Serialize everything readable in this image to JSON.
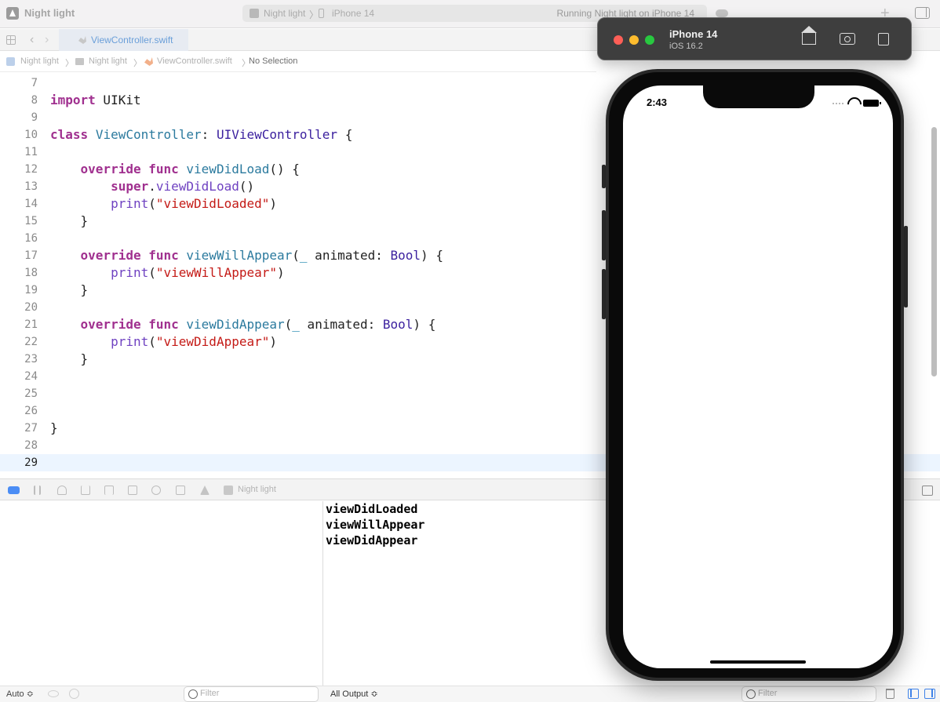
{
  "window": {
    "title": "Night light",
    "scheme": "Night light",
    "device": "iPhone 14",
    "separator": "〉",
    "status": "Running Night light on iPhone 14"
  },
  "tabs": [
    {
      "label": "ViewController.swift",
      "active": true
    }
  ],
  "breadcrumb": {
    "items": [
      "Night light",
      "Night light",
      "ViewController.swift",
      "No Selection"
    ],
    "separator": "〉"
  },
  "editor": {
    "current_line": 29,
    "lines": [
      {
        "n": "7",
        "tokens": []
      },
      {
        "n": "8",
        "tokens": [
          {
            "t": "import",
            "c": "kw"
          },
          {
            "t": " UIKit",
            "c": ""
          }
        ]
      },
      {
        "n": "9",
        "tokens": []
      },
      {
        "n": "10",
        "tokens": [
          {
            "t": "class",
            "c": "kw"
          },
          {
            "t": " ",
            "c": ""
          },
          {
            "t": "ViewController",
            "c": "fn"
          },
          {
            "t": ": ",
            "c": ""
          },
          {
            "t": "UIViewController",
            "c": "tp"
          },
          {
            "t": " {",
            "c": ""
          }
        ]
      },
      {
        "n": "11",
        "tokens": []
      },
      {
        "n": "12",
        "tokens": [
          {
            "t": "    ",
            "c": ""
          },
          {
            "t": "override",
            "c": "kw"
          },
          {
            "t": " ",
            "c": ""
          },
          {
            "t": "func",
            "c": "kw"
          },
          {
            "t": " ",
            "c": ""
          },
          {
            "t": "viewDidLoad",
            "c": "fn"
          },
          {
            "t": "() {",
            "c": ""
          }
        ]
      },
      {
        "n": "13",
        "tokens": [
          {
            "t": "        ",
            "c": ""
          },
          {
            "t": "super",
            "c": "kw"
          },
          {
            "t": ".",
            "c": ""
          },
          {
            "t": "viewDidLoad",
            "c": "fc"
          },
          {
            "t": "()",
            "c": ""
          }
        ]
      },
      {
        "n": "14",
        "tokens": [
          {
            "t": "        ",
            "c": ""
          },
          {
            "t": "print",
            "c": "fc"
          },
          {
            "t": "(",
            "c": ""
          },
          {
            "t": "\"viewDidLoaded\"",
            "c": "st"
          },
          {
            "t": ")",
            "c": ""
          }
        ]
      },
      {
        "n": "15",
        "tokens": [
          {
            "t": "    }",
            "c": ""
          }
        ]
      },
      {
        "n": "16",
        "tokens": []
      },
      {
        "n": "17",
        "tokens": [
          {
            "t": "    ",
            "c": ""
          },
          {
            "t": "override",
            "c": "kw"
          },
          {
            "t": " ",
            "c": ""
          },
          {
            "t": "func",
            "c": "kw"
          },
          {
            "t": " ",
            "c": ""
          },
          {
            "t": "viewWillAppear",
            "c": "fn"
          },
          {
            "t": "(",
            "c": ""
          },
          {
            "t": "_",
            "c": "un"
          },
          {
            "t": " animated: ",
            "c": ""
          },
          {
            "t": "Bool",
            "c": "tp"
          },
          {
            "t": ") {",
            "c": ""
          }
        ]
      },
      {
        "n": "18",
        "tokens": [
          {
            "t": "        ",
            "c": ""
          },
          {
            "t": "print",
            "c": "fc"
          },
          {
            "t": "(",
            "c": ""
          },
          {
            "t": "\"viewWillAppear\"",
            "c": "st"
          },
          {
            "t": ")",
            "c": ""
          }
        ]
      },
      {
        "n": "19",
        "tokens": [
          {
            "t": "    }",
            "c": ""
          }
        ]
      },
      {
        "n": "20",
        "tokens": []
      },
      {
        "n": "21",
        "tokens": [
          {
            "t": "    ",
            "c": ""
          },
          {
            "t": "override",
            "c": "kw"
          },
          {
            "t": " ",
            "c": ""
          },
          {
            "t": "func",
            "c": "kw"
          },
          {
            "t": " ",
            "c": ""
          },
          {
            "t": "viewDidAppear",
            "c": "fn"
          },
          {
            "t": "(",
            "c": ""
          },
          {
            "t": "_",
            "c": "un"
          },
          {
            "t": " animated: ",
            "c": ""
          },
          {
            "t": "Bool",
            "c": "tp"
          },
          {
            "t": ") {",
            "c": ""
          }
        ]
      },
      {
        "n": "22",
        "tokens": [
          {
            "t": "        ",
            "c": ""
          },
          {
            "t": "print",
            "c": "fc"
          },
          {
            "t": "(",
            "c": ""
          },
          {
            "t": "\"viewDidAppear\"",
            "c": "st"
          },
          {
            "t": ")",
            "c": ""
          }
        ]
      },
      {
        "n": "23",
        "tokens": [
          {
            "t": "    }",
            "c": ""
          }
        ]
      },
      {
        "n": "24",
        "tokens": []
      },
      {
        "n": "25",
        "tokens": []
      },
      {
        "n": "26",
        "tokens": []
      },
      {
        "n": "27",
        "tokens": [
          {
            "t": "}",
            "c": ""
          }
        ]
      },
      {
        "n": "28",
        "tokens": []
      },
      {
        "n": "29",
        "tokens": []
      }
    ]
  },
  "debugbar": {
    "app_label": "Night light"
  },
  "console": {
    "output": [
      "viewDidLoaded",
      "viewWillAppear",
      "viewDidAppear"
    ]
  },
  "bottombar": {
    "auto_select": "Auto ≎",
    "filter_left_placeholder": "Filter",
    "output_select": "All Output ≎",
    "filter_right_placeholder": "Filter"
  },
  "simulator": {
    "device_name": "iPhone 14",
    "os_version": "iOS 16.2",
    "time": "2:43"
  },
  "colors": {
    "keyword": "#a0308f",
    "type": "#3a1f9e",
    "string": "#c41a16",
    "accent": "#3f82e8",
    "traffic_close": "#fe5f57",
    "traffic_min": "#febc2e",
    "traffic_max": "#28c840"
  },
  "icons": [
    "app-icon",
    "cloud-icon",
    "add-icon",
    "split-view-icon",
    "grid-icon",
    "back-icon",
    "forward-icon",
    "swift-file-icon",
    "folder-icon",
    "home-icon",
    "screenshot-icon",
    "rotate-icon",
    "wifi-icon",
    "battery-icon",
    "trash-icon",
    "filter-icon"
  ]
}
